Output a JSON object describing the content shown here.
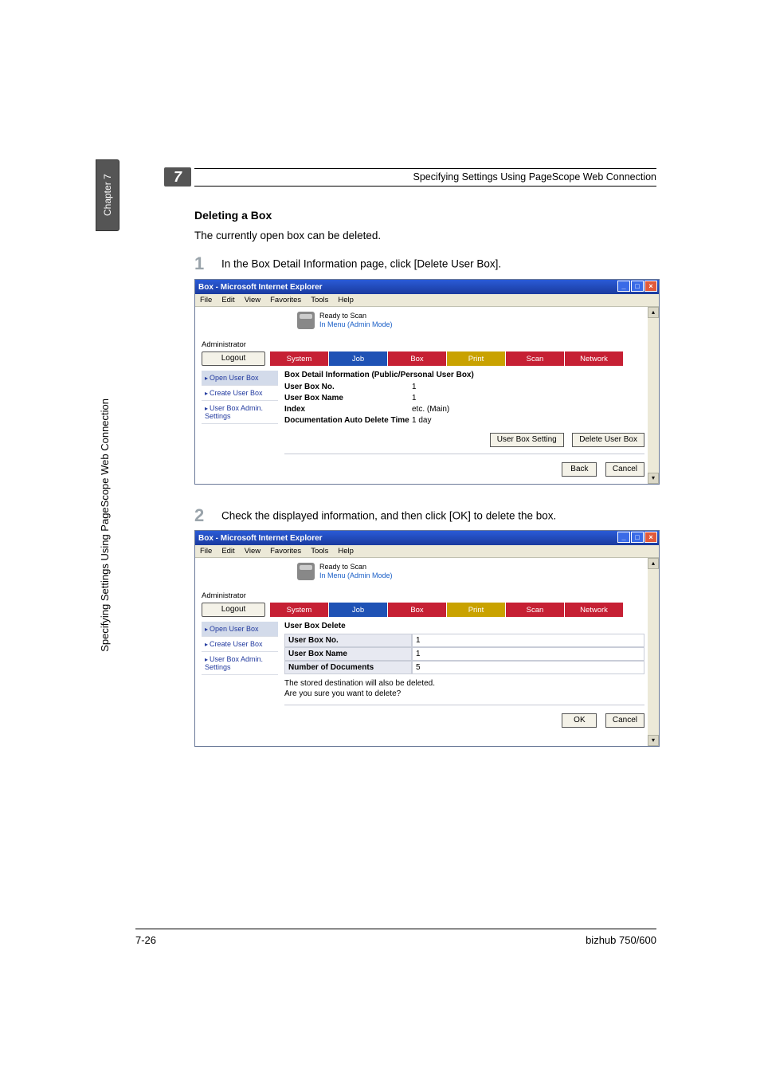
{
  "sidebar": {
    "chapter_label": "Chapter 7",
    "vertical_title": "Specifying Settings Using PageScope Web Connection"
  },
  "header": {
    "chapter_num": "7",
    "title": "Specifying Settings Using PageScope Web Connection"
  },
  "section": {
    "heading": "Deleting a Box",
    "intro": "The currently open box can be deleted."
  },
  "steps": {
    "s1_num": "1",
    "s1_text": "In the Box Detail Information page, click [Delete User Box].",
    "s2_num": "2",
    "s2_text": "Check the displayed information, and then click [OK] to delete the box."
  },
  "window": {
    "title": "Box - Microsoft Internet Explorer",
    "menu": [
      "File",
      "Edit",
      "View",
      "Favorites",
      "Tools",
      "Help"
    ],
    "status_line1": "Ready to Scan",
    "status_line2": "In Menu (Admin Mode)",
    "admin_label": "Administrator",
    "logout": "Logout",
    "tabs": [
      "System",
      "Job",
      "Box",
      "Print",
      "Scan",
      "Network"
    ],
    "nav": [
      "Open User Box",
      "Create User Box",
      "User Box Admin. Settings"
    ]
  },
  "shot1": {
    "title": "Box Detail Information (Public/Personal User Box)",
    "rows": {
      "k1": "User Box No.",
      "v1": "1",
      "k2": "User Box Name",
      "v2": "1",
      "k3": "Index",
      "v3": "etc. (Main)",
      "k4": "Documentation Auto Delete Time",
      "v4": "1 day"
    },
    "btn_setting": "User Box Setting",
    "btn_delete": "Delete User Box",
    "btn_back": "Back",
    "btn_cancel": "Cancel"
  },
  "shot2": {
    "title": "User Box Delete",
    "rows": {
      "k1": "User Box No.",
      "v1": "1",
      "k2": "User Box Name",
      "v2": "1",
      "k3": "Number of Documents",
      "v3": "5"
    },
    "info1": "The stored destination will also be deleted.",
    "info2": "Are you sure you want to delete?",
    "btn_ok": "OK",
    "btn_cancel": "Cancel"
  },
  "footer": {
    "left": "7-26",
    "right": "bizhub 750/600"
  }
}
